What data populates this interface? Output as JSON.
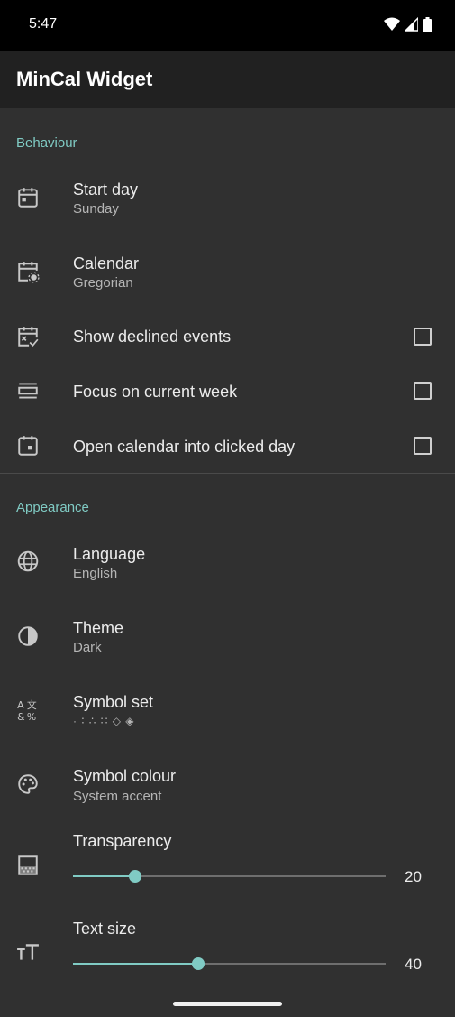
{
  "status": {
    "time": "5:47"
  },
  "app": {
    "title": "MinCal Widget"
  },
  "behaviour": {
    "header": "Behaviour",
    "start_day": {
      "title": "Start day",
      "value": "Sunday"
    },
    "calendar": {
      "title": "Calendar",
      "value": "Gregorian"
    },
    "show_declined": {
      "title": "Show declined events",
      "checked": false
    },
    "focus_week": {
      "title": "Focus on current week",
      "checked": false
    },
    "open_clicked_day": {
      "title": "Open calendar into clicked day",
      "checked": false
    }
  },
  "appearance": {
    "header": "Appearance",
    "language": {
      "title": "Language",
      "value": "English"
    },
    "theme": {
      "title": "Theme",
      "value": "Dark"
    },
    "symbol_set": {
      "title": "Symbol set",
      "value": "· ∶ ∴ ∷ ◇ ◈"
    },
    "symbol_colour": {
      "title": "Symbol colour",
      "value": "System accent"
    },
    "transparency": {
      "title": "Transparency",
      "value": "20",
      "fraction": 0.2
    },
    "text_size": {
      "title": "Text size",
      "value": "40",
      "fraction": 0.4
    }
  },
  "colors": {
    "accent": "#80cbc4",
    "background": "#303030",
    "app_bar": "#212121"
  }
}
